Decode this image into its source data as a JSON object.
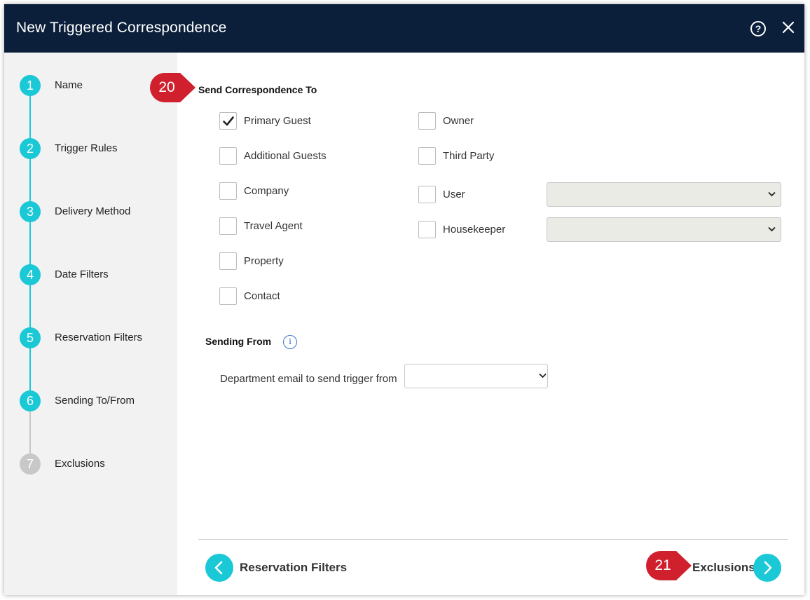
{
  "dialog": {
    "title": "New Triggered Correspondence",
    "help_icon": "question-circle-icon",
    "close_icon": "close-icon"
  },
  "steps": [
    {
      "number": "1",
      "label": "Name",
      "state": "done"
    },
    {
      "number": "2",
      "label": "Trigger Rules",
      "state": "done"
    },
    {
      "number": "3",
      "label": "Delivery Method",
      "state": "done"
    },
    {
      "number": "4",
      "label": "Date Filters",
      "state": "done"
    },
    {
      "number": "5",
      "label": "Reservation Filters",
      "state": "done"
    },
    {
      "number": "6",
      "label": "Sending To/From",
      "state": "current"
    },
    {
      "number": "7",
      "label": "Exclusions",
      "state": "upcoming"
    }
  ],
  "colors": {
    "titlebar": "#0b1f3b",
    "accent": "#1ac8d6",
    "inactive_step": "#c8c8c8",
    "callout": "#d0202e"
  },
  "send_to": {
    "title": "Send Correspondence To",
    "left": [
      {
        "label": "Primary Guest",
        "checked": true
      },
      {
        "label": "Additional Guests",
        "checked": false
      },
      {
        "label": "Company",
        "checked": false
      },
      {
        "label": "Travel Agent",
        "checked": false
      },
      {
        "label": "Property",
        "checked": false
      },
      {
        "label": "Contact",
        "checked": false
      }
    ],
    "right": [
      {
        "label": "Owner",
        "checked": false
      },
      {
        "label": "Third Party",
        "checked": false
      },
      {
        "label": "User",
        "checked": false,
        "select_value": ""
      },
      {
        "label": "Housekeeper",
        "checked": false,
        "select_value": ""
      }
    ]
  },
  "sending_from": {
    "title": "Sending From",
    "info_icon": "info-icon",
    "department_label": "Department email to send trigger from",
    "department_value": ""
  },
  "footer": {
    "back_label": "Reservation Filters",
    "next_label": "Exclusions"
  },
  "callouts": {
    "first": "20",
    "second": "21"
  }
}
